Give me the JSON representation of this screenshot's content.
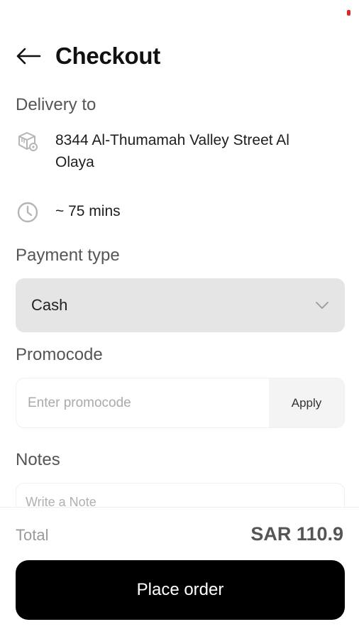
{
  "header": {
    "title": "Checkout",
    "back_icon": "arrow-left-icon"
  },
  "delivery": {
    "label": "Delivery to",
    "address": "8344 Al-Thumamah Valley Street Al Olaya",
    "address_icon": "package-icon",
    "eta": "~ 75 mins",
    "eta_icon": "clock-icon"
  },
  "payment": {
    "label": "Payment type",
    "selected": "Cash",
    "dropdown_icon": "chevron-down-icon"
  },
  "promocode": {
    "label": "Promocode",
    "placeholder": "Enter promocode",
    "value": "",
    "apply_label": "Apply"
  },
  "notes": {
    "label": "Notes",
    "placeholder": "Write a Note",
    "value": ""
  },
  "summary": {
    "total_label": "Total",
    "total_value": "SAR 110.9"
  },
  "actions": {
    "place_order_label": "Place order"
  },
  "colors": {
    "accent": "#000000",
    "status_indicator": "#e0262b",
    "select_bg": "#e5e5e5"
  }
}
